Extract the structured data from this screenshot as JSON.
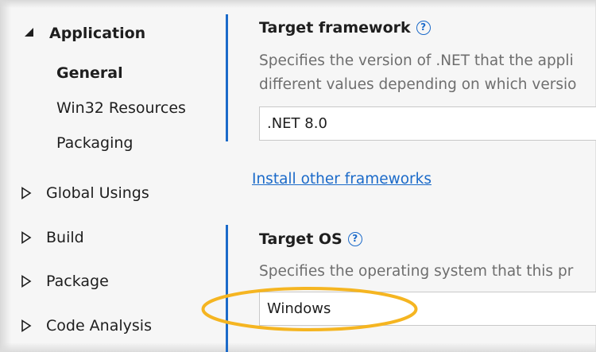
{
  "sidebar": {
    "application": {
      "label": "Application",
      "expanded": true
    },
    "sub_items": [
      {
        "label": "General",
        "selected": true
      },
      {
        "label": "Win32 Resources"
      },
      {
        "label": "Packaging"
      }
    ],
    "collapsed_items": [
      {
        "label": "Global Usings"
      },
      {
        "label": "Build"
      },
      {
        "label": "Package"
      },
      {
        "label": "Code Analysis"
      }
    ]
  },
  "target_framework": {
    "title": "Target framework",
    "help_icon": "question-circle-icon",
    "description_line1": "Specifies the version of .NET that the appli",
    "description_line2": "different values depending on which versio",
    "value": ".NET 8.0",
    "link_label": "Install other frameworks"
  },
  "target_os": {
    "title": "Target OS",
    "help_icon": "question-circle-icon",
    "description": "Specifies the operating system that this pr",
    "value": "Windows"
  },
  "colors": {
    "accent": "#1b6ac9",
    "highlight": "#f5b521",
    "link": "#1b6ac9",
    "description_text": "#6e6e6e"
  }
}
